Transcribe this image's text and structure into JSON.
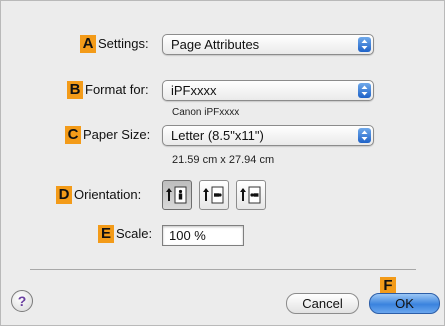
{
  "settings": {
    "badge": "A",
    "label": "Settings:",
    "value": "Page Attributes"
  },
  "format": {
    "badge": "B",
    "label": "Format for:",
    "value": "iPFxxxx",
    "sub": "Canon iPFxxxx"
  },
  "paper": {
    "badge": "C",
    "label": "Paper Size:",
    "value": "Letter (8.5\"x11\")",
    "sub": "21.59 cm x 27.94 cm"
  },
  "orientation": {
    "badge": "D",
    "label": "Orientation:",
    "selected": "portrait",
    "options": [
      "portrait",
      "landscape-left",
      "landscape-right"
    ]
  },
  "scale": {
    "badge": "E",
    "label": "Scale:",
    "value": "100 %"
  },
  "buttons": {
    "help": "?",
    "cancel": "Cancel",
    "ok_badge": "F",
    "ok": "OK"
  },
  "colors": {
    "badge": "#f39b19",
    "accent": "#3a83de"
  }
}
